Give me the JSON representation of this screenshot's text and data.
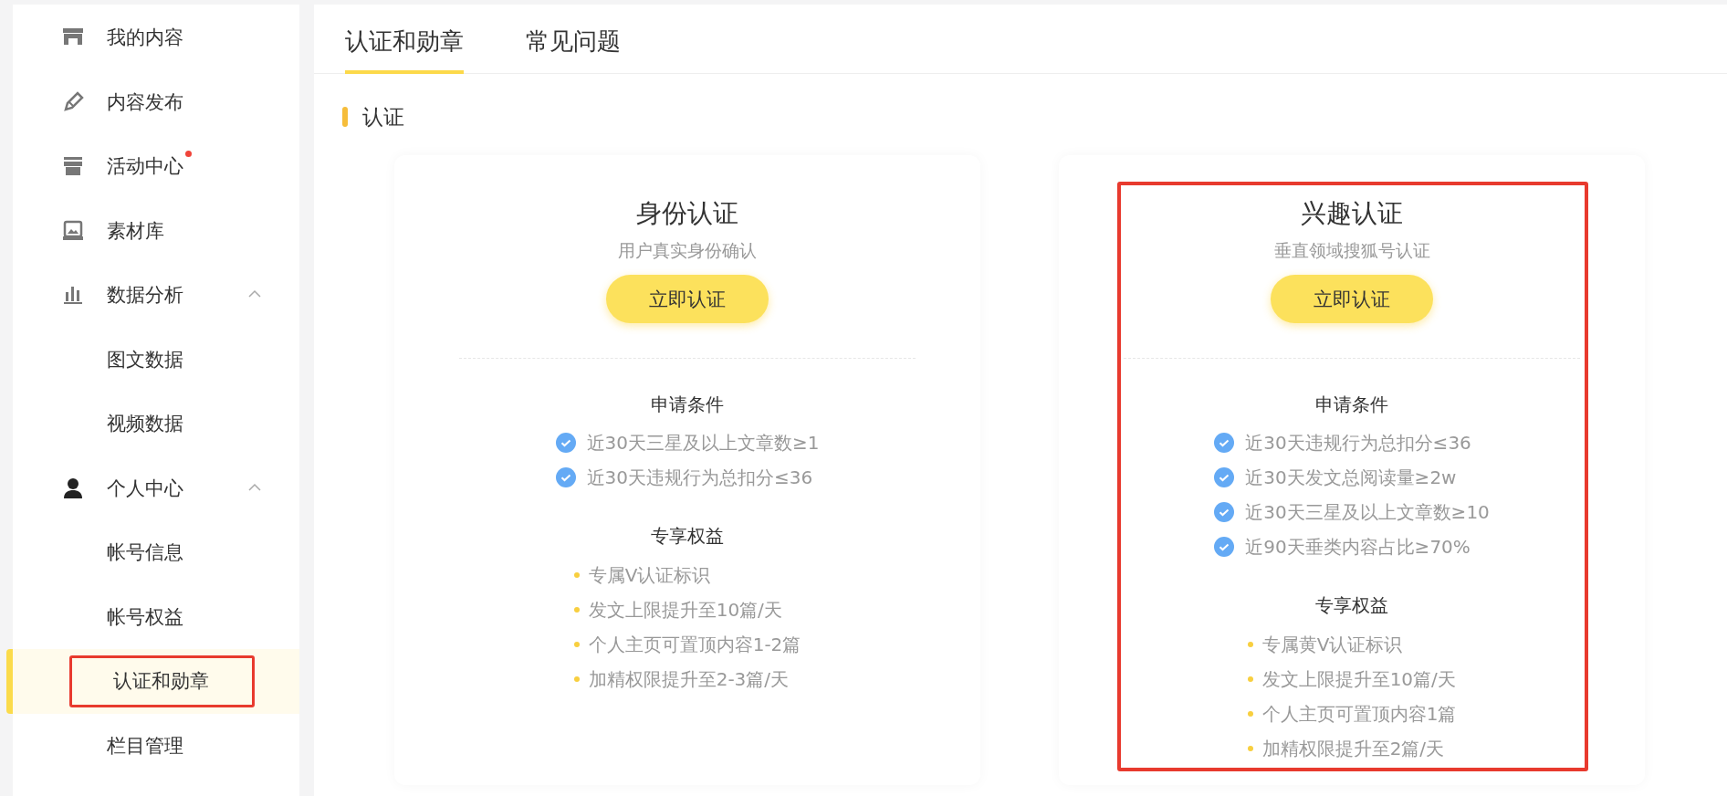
{
  "sidebar": {
    "items": [
      {
        "label": "我的内容",
        "kind": "store",
        "selected": false,
        "badge_dot": false
      },
      {
        "label": "内容发布",
        "kind": "pen",
        "selected": false,
        "badge_dot": false
      },
      {
        "label": "活动中心",
        "kind": "gift",
        "selected": false,
        "badge_dot": true
      },
      {
        "label": "素材库",
        "kind": "image",
        "selected": false,
        "badge_dot": false
      },
      {
        "label": "数据分析",
        "kind": "chart",
        "selected": false,
        "badge_dot": false,
        "expanded": true,
        "children": [
          {
            "label": "图文数据",
            "selected": false,
            "annotated": false
          },
          {
            "label": "视频数据",
            "selected": false,
            "annotated": false
          }
        ]
      },
      {
        "label": "个人中心",
        "kind": "user",
        "selected": false,
        "badge_dot": false,
        "expanded": true,
        "children": [
          {
            "label": "帐号信息",
            "selected": false,
            "annotated": false
          },
          {
            "label": "帐号权益",
            "selected": false,
            "annotated": false
          },
          {
            "label": "认证和勋章",
            "selected": true,
            "annotated": true
          },
          {
            "label": "栏目管理",
            "selected": false,
            "annotated": false
          }
        ]
      }
    ]
  },
  "tabs": [
    {
      "label": "认证和勋章",
      "selected": true
    },
    {
      "label": "常见问题",
      "selected": false
    }
  ],
  "section": {
    "title": "认证"
  },
  "cards": [
    {
      "title": "身份认证",
      "subtitle": "用户真实身份确认",
      "button": "立即认证",
      "annotated": false,
      "requirements": {
        "title": "申请条件",
        "items": [
          "近30天三星及以上文章数≥1",
          "近30天违规行为总扣分≤36"
        ]
      },
      "benefits": {
        "title": "专享权益",
        "items": [
          "专属V认证标识",
          "发文上限提升至10篇/天",
          "个人主页可置顶内容1-2篇",
          "加精权限提升至2-3篇/天"
        ]
      }
    },
    {
      "title": "兴趣认证",
      "subtitle": "垂直领域搜狐号认证",
      "button": "立即认证",
      "annotated": true,
      "requirements": {
        "title": "申请条件",
        "items": [
          "近30天违规行为总扣分≤36",
          "近30天发文总阅读量≥2w",
          "近30天三星及以上文章数≥10",
          "近90天垂类内容占比≥70%"
        ]
      },
      "benefits": {
        "title": "专享权益",
        "items": [
          "专属黄V认证标识",
          "发文上限提升至10篇/天",
          "个人主页可置顶内容1篇",
          "加精权限提升至2篇/天"
        ]
      }
    }
  ]
}
